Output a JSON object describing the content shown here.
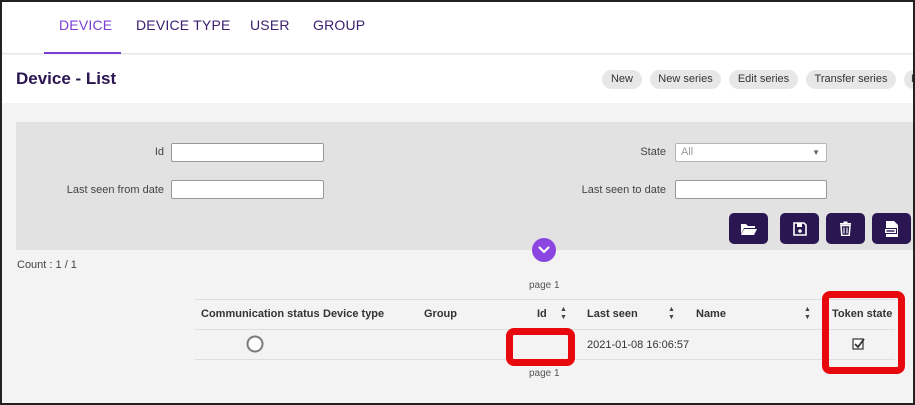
{
  "nav": {
    "tabs": [
      {
        "label": "DEVICE",
        "active": true
      },
      {
        "label": "DEVICE TYPE",
        "active": false
      },
      {
        "label": "USER",
        "active": false
      },
      {
        "label": "GROUP",
        "active": false
      }
    ]
  },
  "header": {
    "title": "Device - List",
    "buttons": [
      "New",
      "New series",
      "Edit series",
      "Transfer series",
      "P"
    ]
  },
  "filters": {
    "id_label": "Id",
    "id_value": "",
    "last_seen_from_label": "Last seen from date",
    "last_seen_from_value": "",
    "state_label": "State",
    "state_value": "All",
    "last_seen_to_label": "Last seen to date",
    "last_seen_to_value": ""
  },
  "actions": {
    "icons": [
      "folder-open-icon",
      "save-icon",
      "trash-icon",
      "csv-icon"
    ]
  },
  "results": {
    "count": "Count : 1 / 1",
    "page_top": "page 1",
    "page_bottom": "page 1"
  },
  "table": {
    "columns": [
      "Communication status",
      "Device type",
      "Group",
      "Id",
      "Last seen",
      "Name",
      "Token state"
    ],
    "rows": [
      {
        "device_type": "",
        "group": "",
        "id": "",
        "last_seen": "2021-01-08 16:06:57",
        "name": "",
        "token_state_checked": true
      }
    ]
  },
  "colors": {
    "accent": "#7b3fd4",
    "dark": "#2a1650",
    "highlight": "#e8090e"
  }
}
